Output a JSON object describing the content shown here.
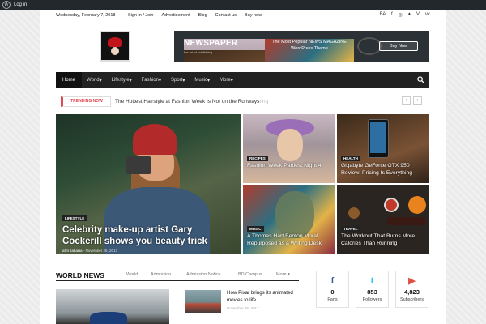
{
  "admin_bar": {
    "login": "Log in"
  },
  "top_bar": {
    "date": "Wednesday, February 7, 2018",
    "links": [
      "Sign in / Join",
      "Advertisement",
      "Blog",
      "Contact us",
      "Buy now"
    ],
    "social_icons": [
      "behance-icon",
      "facebook-icon",
      "instagram-icon",
      "twitter-icon",
      "vimeo-icon",
      "vk-icon"
    ]
  },
  "banner": {
    "title": "NEWSPAPER",
    "tagline": "the art of publishing",
    "headline": "The Most Popular NEWS MAGAZINE WordPress Theme",
    "button": "Buy Now"
  },
  "nav": {
    "items": [
      {
        "label": "Home"
      },
      {
        "label": "World"
      },
      {
        "label": "Lifestyle"
      },
      {
        "label": "Fashion"
      },
      {
        "label": "Sport"
      },
      {
        "label": "Music"
      },
      {
        "label": "More"
      }
    ]
  },
  "trending": {
    "label": "TRENDING NOW",
    "text": "The Hottest Hairstyle at Fashion Week Is Not on the Runways",
    "ghost": "ring"
  },
  "featured": {
    "big": {
      "category": "LIFESTYLE",
      "title": "Celebrity make-up artist Gary Cockerill shows you beauty trick",
      "author": "atm zakaria",
      "date": "November 26, 2017"
    },
    "tiles": [
      {
        "category": "RECIPES",
        "title": "Fashion Week Parties: Night 4"
      },
      {
        "category": "HEALTH",
        "title": "Gigabyte GeForce GTX 950 Review: Pricing Is Everything"
      },
      {
        "category": "MUSIC",
        "title": "A Thomas Hart Benton Mural Repurposed as a Writing Desk"
      },
      {
        "category": "TRAVEL",
        "title": "The Workout That Burns More Calories Than Running"
      }
    ]
  },
  "world_news": {
    "heading": "WORLD NEWS",
    "tabs": [
      "World",
      "Admission",
      "Admission Notice",
      "BD Campus",
      "More"
    ],
    "article": {
      "title": "How Pixar brings its animated movies to life",
      "date": "November 26, 2017"
    }
  },
  "social_counters": [
    {
      "icon": "f",
      "count": "0",
      "label": "Fans",
      "color": "#3b5998"
    },
    {
      "icon": "t",
      "count": "853",
      "label": "Followers",
      "color": "#29c5f6"
    },
    {
      "icon": "▶",
      "count": "4,823",
      "label": "Subscribers",
      "color": "#e14e42"
    }
  ]
}
